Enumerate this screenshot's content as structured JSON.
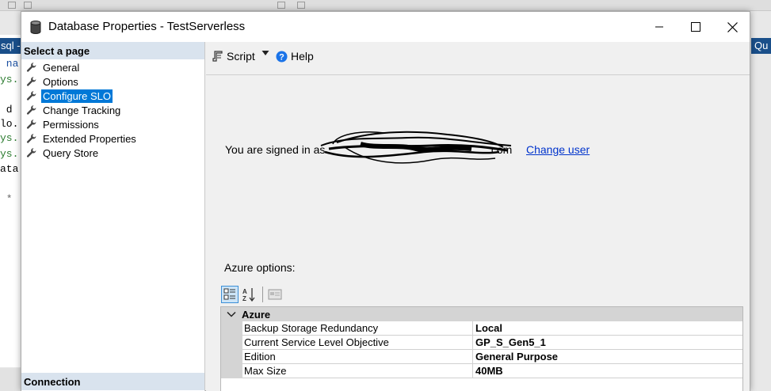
{
  "window": {
    "title": "Database Properties - TestServerless"
  },
  "background": {
    "left_tab": "sql -",
    "right_tab": "Qu",
    "code_lines": [
      " na",
      "ys.",
      "",
      " d",
      "lo.",
      "ys.",
      "ys.",
      "ata",
      "",
      " *"
    ]
  },
  "left_pane": {
    "header": "Select a page",
    "pages": [
      {
        "label": "General",
        "selected": false
      },
      {
        "label": "Options",
        "selected": false
      },
      {
        "label": "Configure SLO",
        "selected": true
      },
      {
        "label": "Change Tracking",
        "selected": false
      },
      {
        "label": "Permissions",
        "selected": false
      },
      {
        "label": "Extended Properties",
        "selected": false
      },
      {
        "label": "Query Store",
        "selected": false
      }
    ],
    "connection_header": "Connection"
  },
  "toolbar": {
    "script_label": "Script",
    "help_label": "Help"
  },
  "content": {
    "signed_in_prefix": "You are signed in as",
    "signed_in_suffix": ".com",
    "change_user_link": "Change user",
    "azure_options_label": "Azure options:"
  },
  "property_grid": {
    "category": "Azure",
    "rows": [
      {
        "name": "Backup Storage Redundancy",
        "value": "Local"
      },
      {
        "name": "Current Service Level Objective",
        "value": "GP_S_Gen5_1"
      },
      {
        "name": "Edition",
        "value": "General Purpose"
      },
      {
        "name": "Max Size",
        "value": "40MB"
      }
    ]
  },
  "colors": {
    "selected_page": "#0078d7",
    "link": "#0033cc",
    "pane_header": "#d9e3ee"
  }
}
